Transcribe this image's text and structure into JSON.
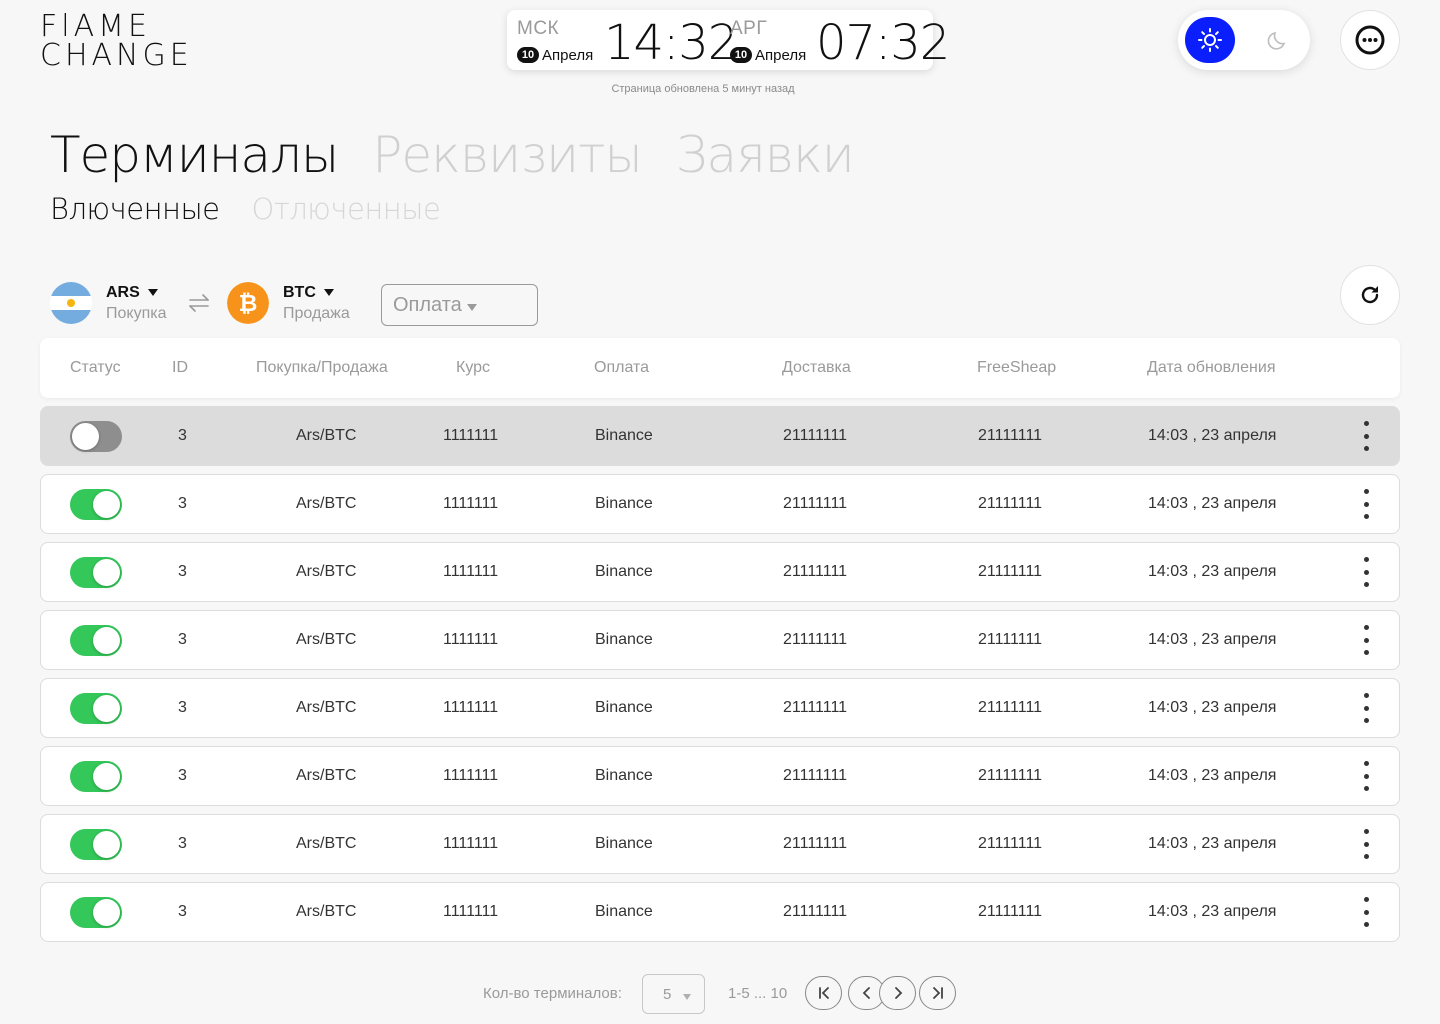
{
  "brand": {
    "line1": "FlAME",
    "line2": "CHANGE"
  },
  "clock": {
    "msk": {
      "code": "МСК",
      "day": "10",
      "month": "Апреля",
      "time": "14:32"
    },
    "arg": {
      "code": "АРГ",
      "day": "10",
      "month": "Апреля",
      "time": "07:32"
    },
    "updated": "Страница обновлена 5 минут назад"
  },
  "theme": {
    "active": "light"
  },
  "tabs": [
    "Терминалы",
    "Реквизиты",
    "Заявки"
  ],
  "subtabs": [
    "Влюченные",
    "Отлюченные"
  ],
  "filters": {
    "buy": {
      "code": "ARS",
      "role": "Покупка"
    },
    "sell": {
      "code": "BTC",
      "role": "Продажа"
    },
    "payment_placeholder": "Оплата"
  },
  "table": {
    "columns": [
      "Статус",
      "ID",
      "Покупка/Продажа",
      "Курс",
      "Оплата",
      "Доставка",
      "FreeSheap",
      "Дата обновления"
    ],
    "rows": [
      {
        "enabled": false,
        "id": "3",
        "pair": "Ars/BTC",
        "rate": "1111111",
        "payment": "Binance",
        "delivery": "21111111",
        "freesheap": "21111111",
        "updated": "14:03 , 23 апреля"
      },
      {
        "enabled": true,
        "id": "3",
        "pair": "Ars/BTC",
        "rate": "1111111",
        "payment": "Binance",
        "delivery": "21111111",
        "freesheap": "21111111",
        "updated": "14:03 , 23 апреля"
      },
      {
        "enabled": true,
        "id": "3",
        "pair": "Ars/BTC",
        "rate": "1111111",
        "payment": "Binance",
        "delivery": "21111111",
        "freesheap": "21111111",
        "updated": "14:03 , 23 апреля"
      },
      {
        "enabled": true,
        "id": "3",
        "pair": "Ars/BTC",
        "rate": "1111111",
        "payment": "Binance",
        "delivery": "21111111",
        "freesheap": "21111111",
        "updated": "14:03 , 23 апреля"
      },
      {
        "enabled": true,
        "id": "3",
        "pair": "Ars/BTC",
        "rate": "1111111",
        "payment": "Binance",
        "delivery": "21111111",
        "freesheap": "21111111",
        "updated": "14:03 , 23 апреля"
      },
      {
        "enabled": true,
        "id": "3",
        "pair": "Ars/BTC",
        "rate": "1111111",
        "payment": "Binance",
        "delivery": "21111111",
        "freesheap": "21111111",
        "updated": "14:03 , 23 апреля"
      },
      {
        "enabled": true,
        "id": "3",
        "pair": "Ars/BTC",
        "rate": "1111111",
        "payment": "Binance",
        "delivery": "21111111",
        "freesheap": "21111111",
        "updated": "14:03 , 23 апреля"
      },
      {
        "enabled": true,
        "id": "3",
        "pair": "Ars/BTC",
        "rate": "1111111",
        "payment": "Binance",
        "delivery": "21111111",
        "freesheap": "21111111",
        "updated": "14:03 , 23 апреля"
      }
    ]
  },
  "pagination": {
    "label": "Кол-во терминалов:",
    "page_size": "5",
    "range": "1-5 ... 10"
  },
  "colors": {
    "accent": "#0a1ffb",
    "toggle_on": "#34c759",
    "toggle_off": "#8e8e8e",
    "bitcoin": "#f7931a"
  },
  "icons": [
    "sun-icon",
    "moon-icon",
    "more-icon",
    "swap-icon",
    "refresh-icon",
    "argentina-flag-icon",
    "bitcoin-icon",
    "first-page-icon",
    "prev-page-icon",
    "next-page-icon",
    "last-page-icon"
  ]
}
